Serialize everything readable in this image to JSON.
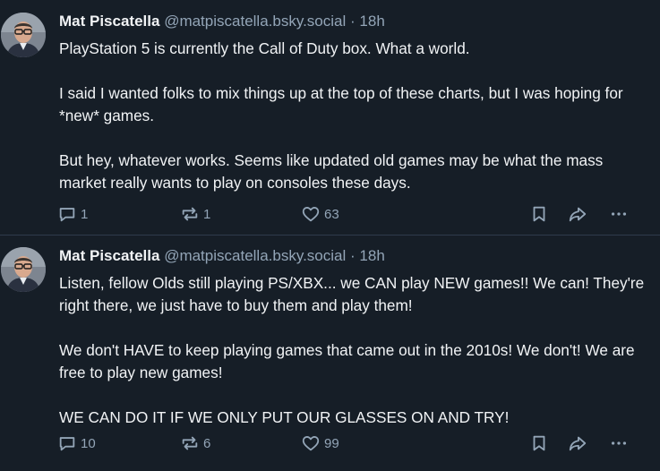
{
  "posts": [
    {
      "author_name": "Mat Piscatella",
      "handle": "@matpiscatella.bsky.social",
      "separator": "·",
      "time": "18h",
      "paragraphs": [
        "PlayStation 5 is currently the Call of Duty box. What a world.",
        "I said I wanted folks to mix things up at the top of these charts, but I was hoping for *new* games.",
        "But hey, whatever works. Seems like updated old games may be what the mass market really wants to play on consoles these days."
      ],
      "replies": "1",
      "reposts": "1",
      "likes": "63"
    },
    {
      "author_name": "Mat Piscatella",
      "handle": "@matpiscatella.bsky.social",
      "separator": "·",
      "time": "18h",
      "paragraphs": [
        "Listen, fellow Olds still playing PS/XBX... we CAN play NEW games!! We can! They're right there, we just have to buy them and play them!",
        "We don't HAVE to keep playing games that came out in the 2010s! We don't! We are free to play new games!",
        "WE CAN DO IT IF WE ONLY PUT OUR GLASSES ON AND TRY!"
      ],
      "replies": "10",
      "reposts": "6",
      "likes": "99"
    }
  ],
  "icons": {
    "reply": "reply-bubble-icon",
    "repost": "repost-arrows-icon",
    "like": "heart-icon",
    "bookmark": "bookmark-icon",
    "share": "share-arrow-icon",
    "more": "ellipsis-icon"
  },
  "colors": {
    "background": "#161e27",
    "text": "#f1f3f5",
    "muted": "#93a5b7",
    "divider": "#2e3b4c"
  }
}
